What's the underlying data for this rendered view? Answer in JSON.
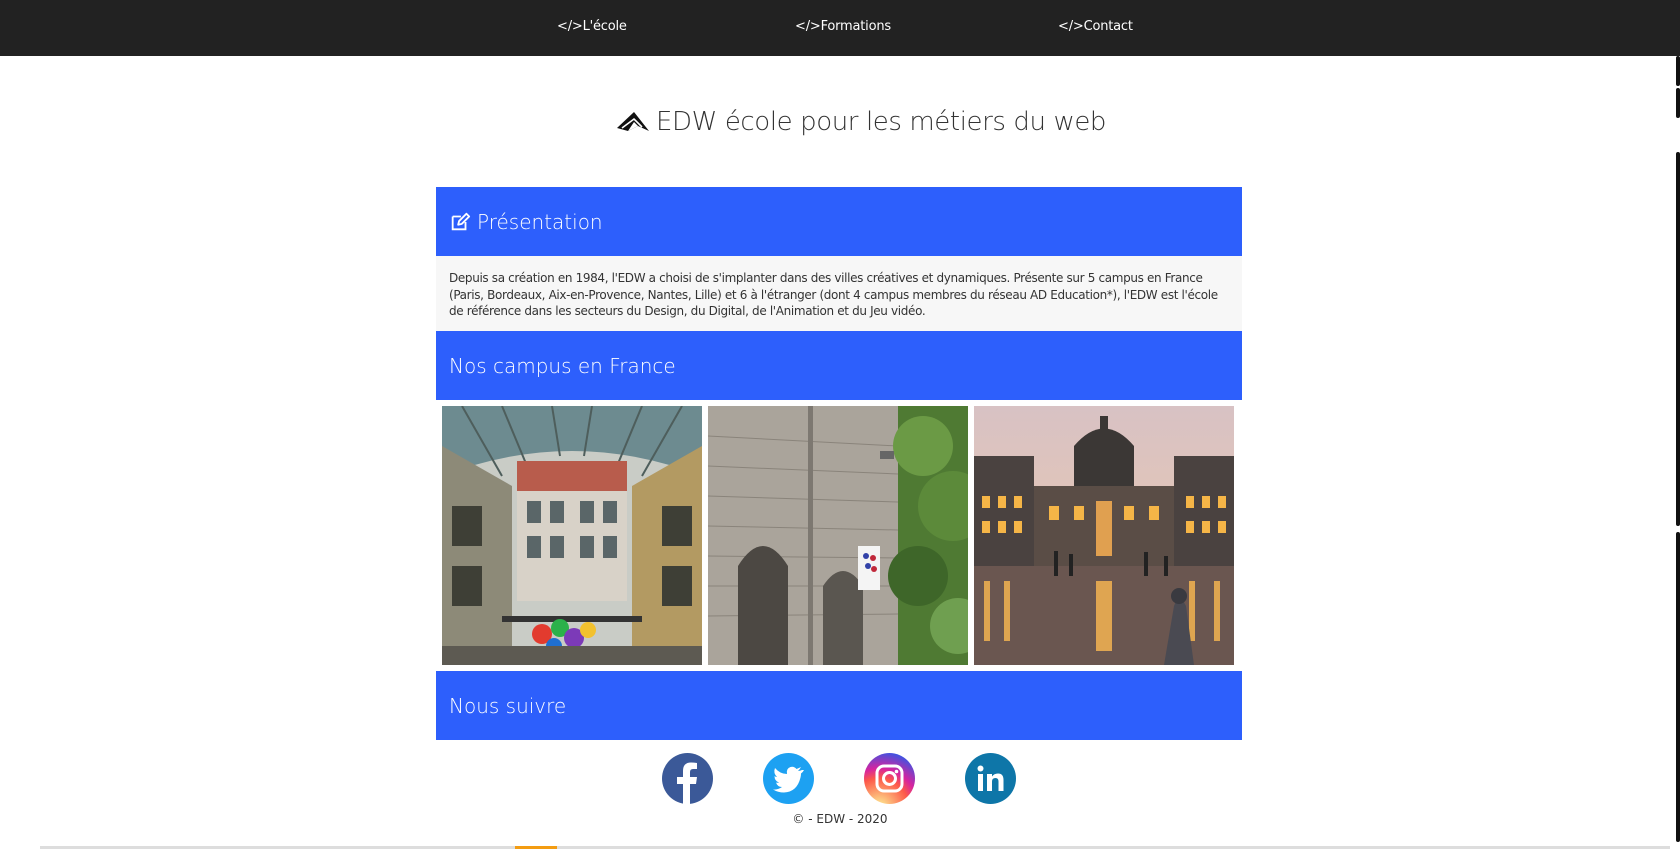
{
  "nav": {
    "items": [
      {
        "label": "</>L'école"
      },
      {
        "label": "</>Formations"
      },
      {
        "label": "</>Contact"
      }
    ]
  },
  "brand": {
    "title": "EDW école pour les métiers du web",
    "icon": "paper-plane-icon"
  },
  "sections": {
    "presentation": {
      "title": "Présentation",
      "icon": "edit-icon",
      "text": "Depuis sa création en 1984, l'EDW a choisi de s'implanter dans des villes créatives et dynamiques. Présente sur 5 campus en France (Paris, Bordeaux, Aix-en-Provence, Nantes, Lille) et 6 à l'étranger (dont 4 campus membres du réseau AD Education*), l'EDW est l'école de référence dans les secteurs du Design, du Digital, de l'Animation et du Jeu vidéo."
    },
    "campus": {
      "title": "Nos campus en France"
    },
    "follow": {
      "title": "Nous suivre"
    }
  },
  "socials": [
    {
      "name": "facebook-icon",
      "color": "#3b5998"
    },
    {
      "name": "twitter-icon",
      "color": "#1da1f2"
    },
    {
      "name": "instagram-icon",
      "color": "#d6249f"
    },
    {
      "name": "linkedin-icon",
      "color": "#0e76a8"
    }
  ],
  "footer": {
    "copyright": "© - EDW - 2020"
  },
  "colors": {
    "nav_bg": "#222222",
    "accent": "#2d5ffc"
  }
}
